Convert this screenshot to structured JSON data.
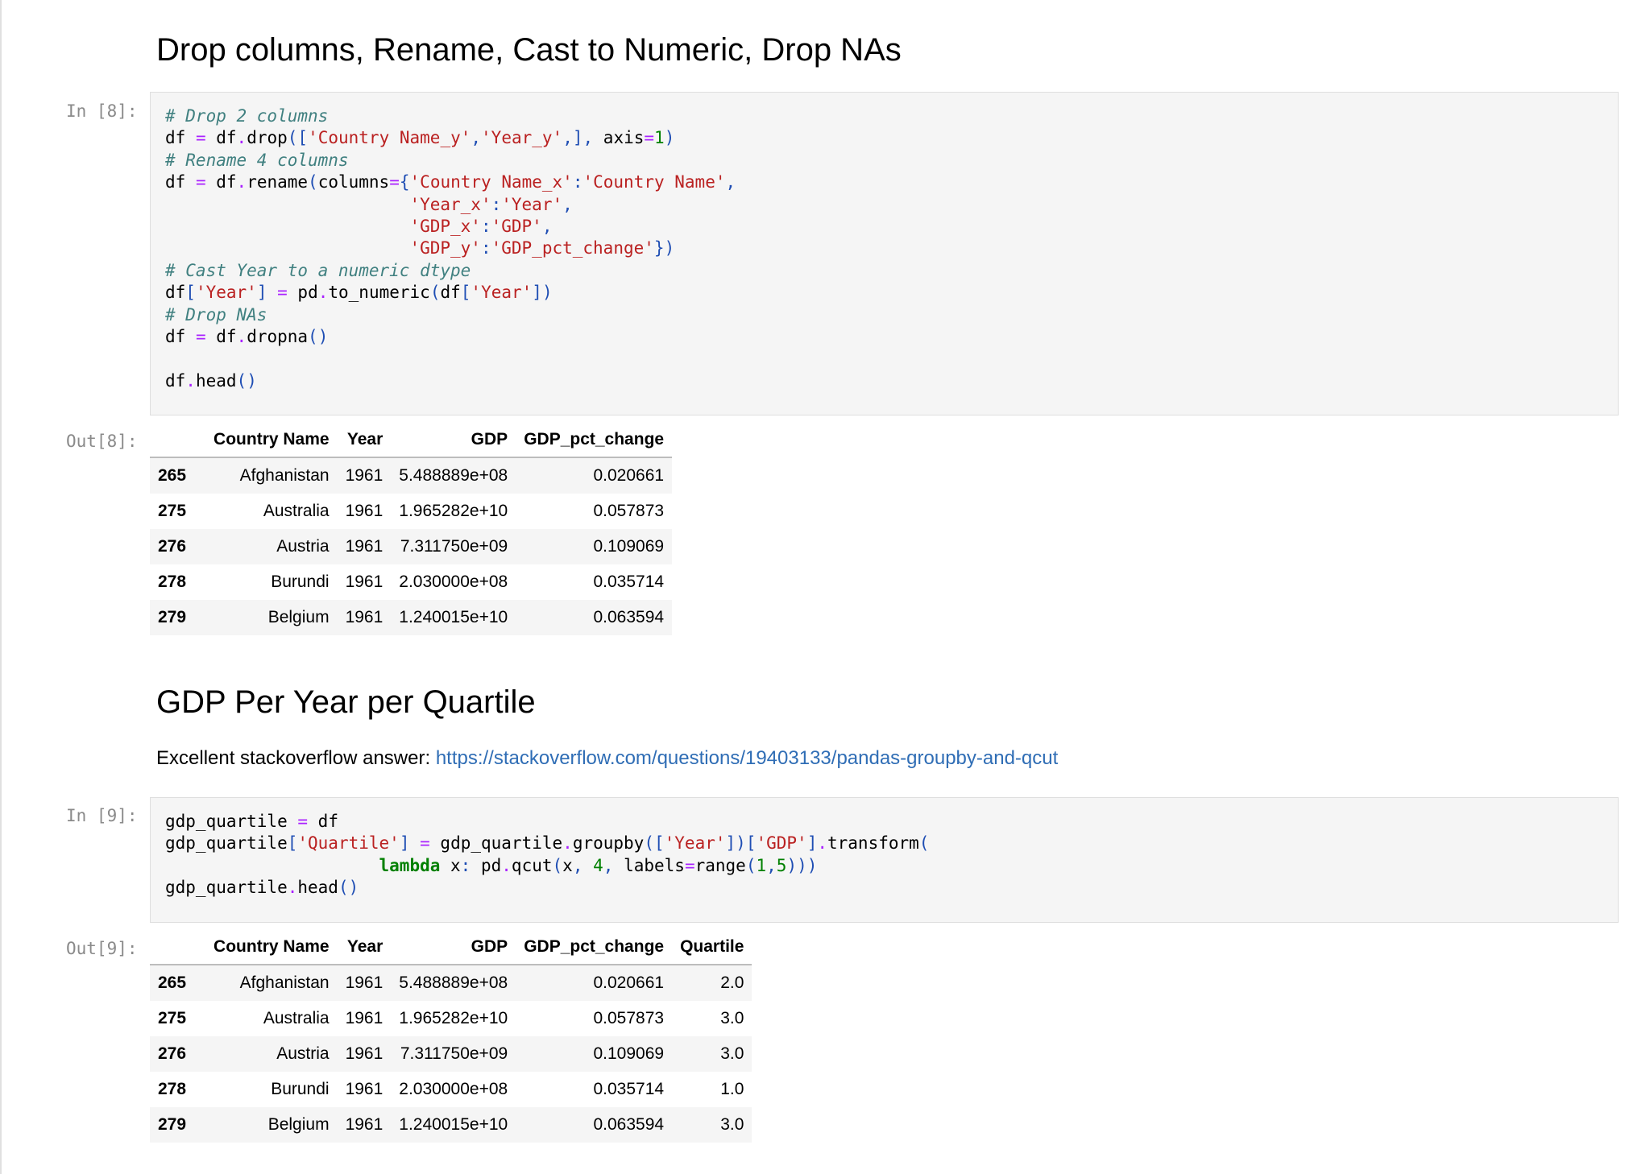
{
  "section1": {
    "heading": "Drop columns, Rename, Cast to Numeric, Drop NAs",
    "in_prompt": "In [8]:",
    "out_prompt": "Out[8]:",
    "code_lines": [
      "# Drop 2 columns",
      "df = df.drop(['Country Name_y','Year_y',], axis=1)",
      "# Rename 4 columns",
      "df = df.rename(columns={'Country Name_x':'Country Name',",
      "                        'Year_x':'Year',",
      "                        'GDP_x':'GDP',",
      "                        'GDP_y':'GDP_pct_change'})",
      "# Cast Year to a numeric dtype",
      "df['Year'] = pd.to_numeric(df['Year'])",
      "# Drop NAs",
      "df = df.dropna()",
      "",
      "df.head()"
    ],
    "table": {
      "columns": [
        "",
        "Country Name",
        "Year",
        "GDP",
        "GDP_pct_change"
      ],
      "rows": [
        [
          "265",
          "Afghanistan",
          "1961",
          "5.488889e+08",
          "0.020661"
        ],
        [
          "275",
          "Australia",
          "1961",
          "1.965282e+10",
          "0.057873"
        ],
        [
          "276",
          "Austria",
          "1961",
          "7.311750e+09",
          "0.109069"
        ],
        [
          "278",
          "Burundi",
          "1961",
          "2.030000e+08",
          "0.035714"
        ],
        [
          "279",
          "Belgium",
          "1961",
          "1.240015e+10",
          "0.063594"
        ]
      ]
    }
  },
  "section2": {
    "heading": "GDP Per Year per Quartile",
    "text": "Excellent stackoverflow answer: ",
    "link": "https://stackoverflow.com/questions/19403133/pandas-groupby-and-qcut",
    "in_prompt": "In [9]:",
    "out_prompt": "Out[9]:",
    "code_lines": [
      "gdp_quartile = df",
      "gdp_quartile['Quartile'] = gdp_quartile.groupby(['Year'])['GDP'].transform(",
      "                     lambda x: pd.qcut(x, 4, labels=range(1,5)))",
      "gdp_quartile.head()"
    ],
    "table": {
      "columns": [
        "",
        "Country Name",
        "Year",
        "GDP",
        "GDP_pct_change",
        "Quartile"
      ],
      "rows": [
        [
          "265",
          "Afghanistan",
          "1961",
          "5.488889e+08",
          "0.020661",
          "2.0"
        ],
        [
          "275",
          "Australia",
          "1961",
          "1.965282e+10",
          "0.057873",
          "3.0"
        ],
        [
          "276",
          "Austria",
          "1961",
          "7.311750e+09",
          "0.109069",
          "3.0"
        ],
        [
          "278",
          "Burundi",
          "1961",
          "2.030000e+08",
          "0.035714",
          "1.0"
        ],
        [
          "279",
          "Belgium",
          "1961",
          "1.240015e+10",
          "0.063594",
          "3.0"
        ]
      ]
    }
  },
  "colors": {
    "comment": "#408080",
    "string": "#ba2121",
    "operator": "#aa22ff",
    "punctuation": "#1f4eb4",
    "number": "#008000",
    "keyword": "#008000",
    "link": "#2f6db5",
    "prompt": "#8a8a8a"
  }
}
